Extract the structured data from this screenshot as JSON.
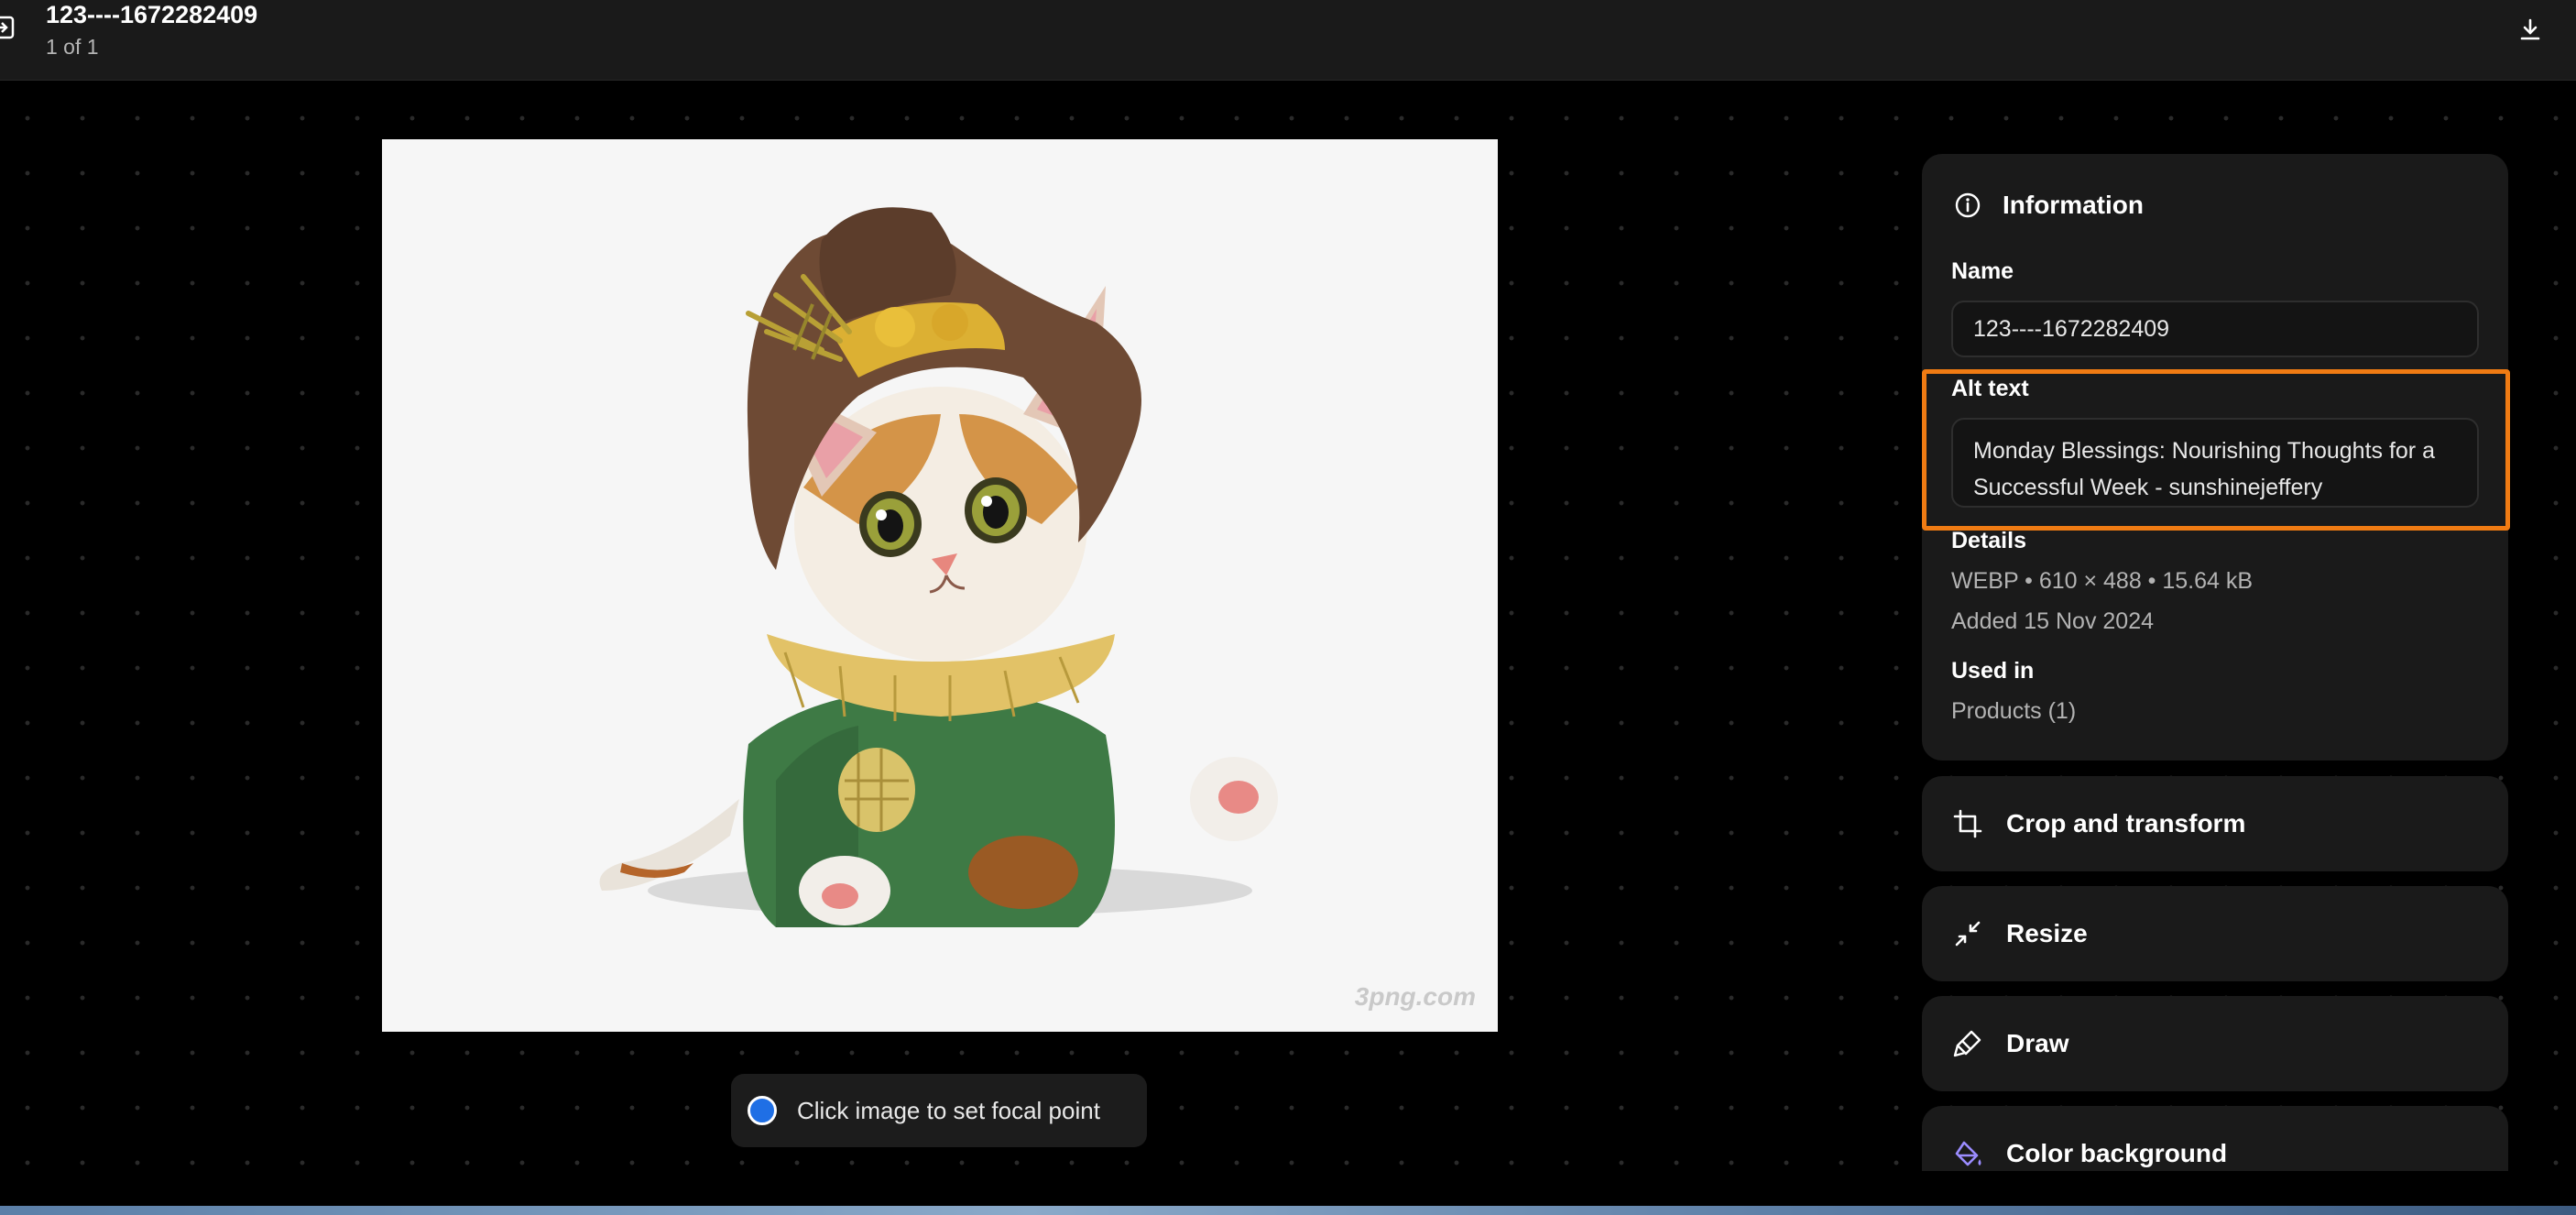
{
  "header": {
    "title": "123----1672282409",
    "count": "1 of 1"
  },
  "preview": {
    "watermark": "3png.com",
    "focal_hint": "Click image to set focal point"
  },
  "info": {
    "title": "Information",
    "name_label": "Name",
    "name_value": "123----1672282409",
    "alt_label": "Alt text",
    "alt_value": "Monday Blessings: Nourishing Thoughts for a Successful Week - sunshinejeffery",
    "details_label": "Details",
    "details_format": "WEBP • 610 × 488 • 15.64 kB",
    "details_added": "Added 15 Nov 2024",
    "used_in_label": "Used in",
    "used_in_value": "Products (1)"
  },
  "tools": {
    "crop": "Crop and transform",
    "resize": "Resize",
    "draw": "Draw",
    "color_bg": "Color background"
  },
  "colors": {
    "highlight": "#f07b13",
    "focal_dot": "#1f6fe5",
    "color_bg_icon": "#9b8cff"
  },
  "icons": {
    "exit": "exit-icon",
    "download": "download-icon",
    "info": "info-icon",
    "crop": "crop-icon",
    "resize": "resize-icon",
    "draw": "brush-icon",
    "color_bg": "paint-bucket-icon"
  }
}
